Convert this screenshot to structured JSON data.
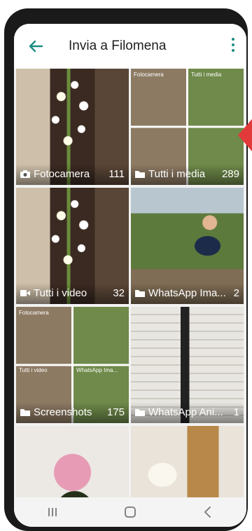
{
  "header": {
    "title": "Invia a Filomena"
  },
  "albums": [
    {
      "name": "Fotocamera",
      "count": "111",
      "icon": "camera-icon",
      "thumb": "flowers"
    },
    {
      "name": "Tutti i media",
      "count": "289",
      "icon": "folder-icon",
      "thumb": "mosaic"
    },
    {
      "name": "Tutti i video",
      "count": "32",
      "icon": "video-icon",
      "thumb": "flowers"
    },
    {
      "name": "WhatsApp Ima...",
      "count": "2",
      "icon": "folder-icon",
      "thumb": "garden"
    },
    {
      "name": "Screenshots",
      "count": "175",
      "icon": "folder-icon",
      "thumb": "mosaic"
    },
    {
      "name": "WhatsApp Ani...",
      "count": "1",
      "icon": "folder-icon",
      "thumb": "balcony"
    },
    {
      "name": "",
      "count": "",
      "icon": "",
      "thumb": "orchid"
    },
    {
      "name": "",
      "count": "",
      "icon": "",
      "thumb": "room"
    }
  ],
  "mini_labels": {
    "fotocamera": "Fotocamera",
    "tutti_media": "Tutti i media",
    "tutti_video": "Tutti i video",
    "whatsapp_ima": "WhatsApp Ima..."
  },
  "colors": {
    "accent": "#1c8c84",
    "arrow": "#e23a3a"
  },
  "nav": {
    "recents": "recents-icon",
    "home": "home-icon",
    "back": "back-nav-icon"
  }
}
